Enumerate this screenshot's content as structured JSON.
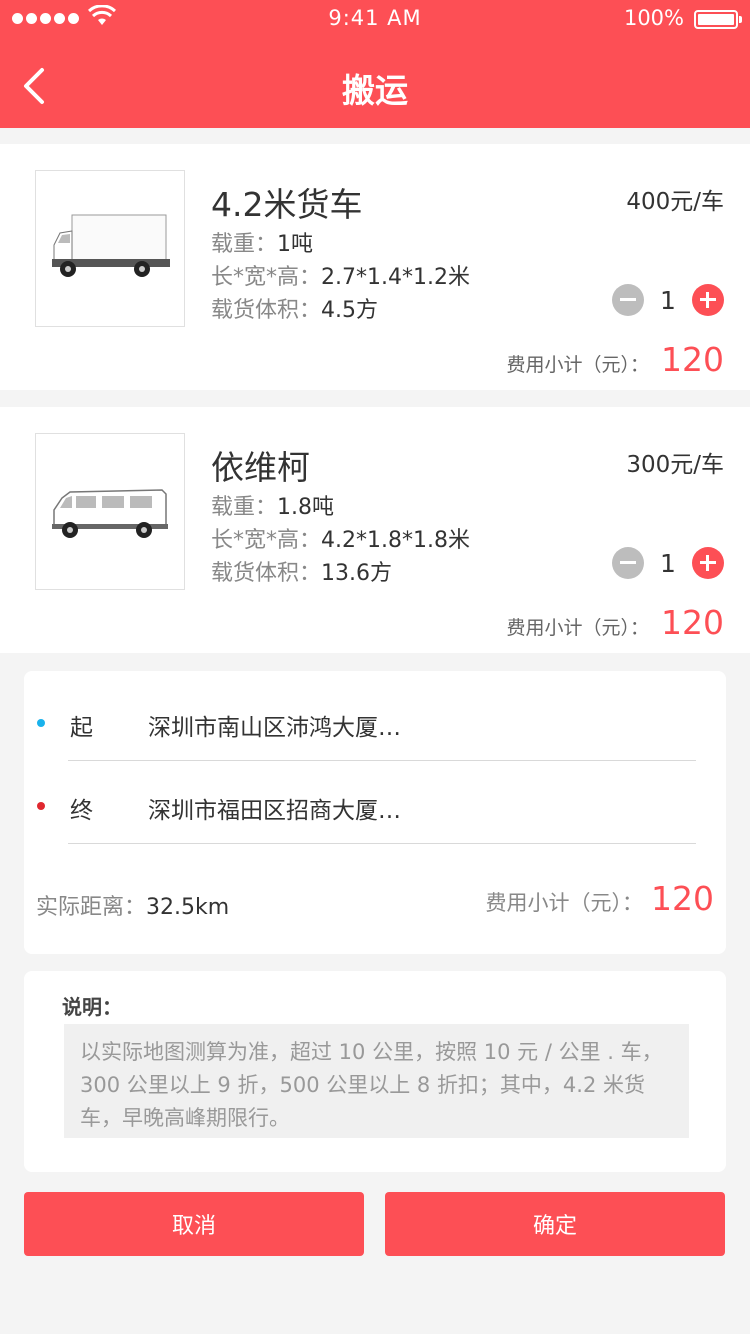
{
  "status_bar": {
    "time": "9:41 AM",
    "battery": "100%"
  },
  "header": {
    "title": "搬运"
  },
  "vehicles": [
    {
      "name": "4.2米货车",
      "price": "400元/车",
      "load_label": "载重：",
      "load": "1吨",
      "dims_label": "长*宽*高：",
      "dims": "2.7*1.4*1.2米",
      "volume_label": "载货体积：",
      "volume": "4.5方",
      "quantity": "1",
      "subtotal_label": "费用小计（元）：",
      "subtotal": "120"
    },
    {
      "name": "依维柯",
      "price": "300元/车",
      "load_label": "载重：",
      "load": "1.8吨",
      "dims_label": "长*宽*高：",
      "dims": "4.2*1.8*1.8米",
      "volume_label": "载货体积：",
      "volume": "13.6方",
      "quantity": "1",
      "subtotal_label": "费用小计（元）：",
      "subtotal": "120"
    }
  ],
  "route": {
    "start_label": "起",
    "start_address": "深圳市南山区沛鸿大厦…",
    "end_label": "终",
    "end_address": "深圳市福田区招商大厦…",
    "distance_label": "实际距离：",
    "distance": "32.5km",
    "subtotal_label": "费用小计（元）：",
    "subtotal": "120",
    "start_color": "#1ab2ec",
    "end_color": "#e0282f"
  },
  "note": {
    "title": "说明：",
    "text": "以实际地图测算为准，超过 10 公里，按照 10 元 / 公里 . 车，300 公里以上 9 折，500 公里以上 8 折扣；其中，4.2 米货车，早晚高峰期限行。"
  },
  "buttons": {
    "cancel": "取消",
    "confirm": "确定"
  },
  "colors": {
    "accent": "#fd4f55",
    "background": "#f4f4f4"
  }
}
